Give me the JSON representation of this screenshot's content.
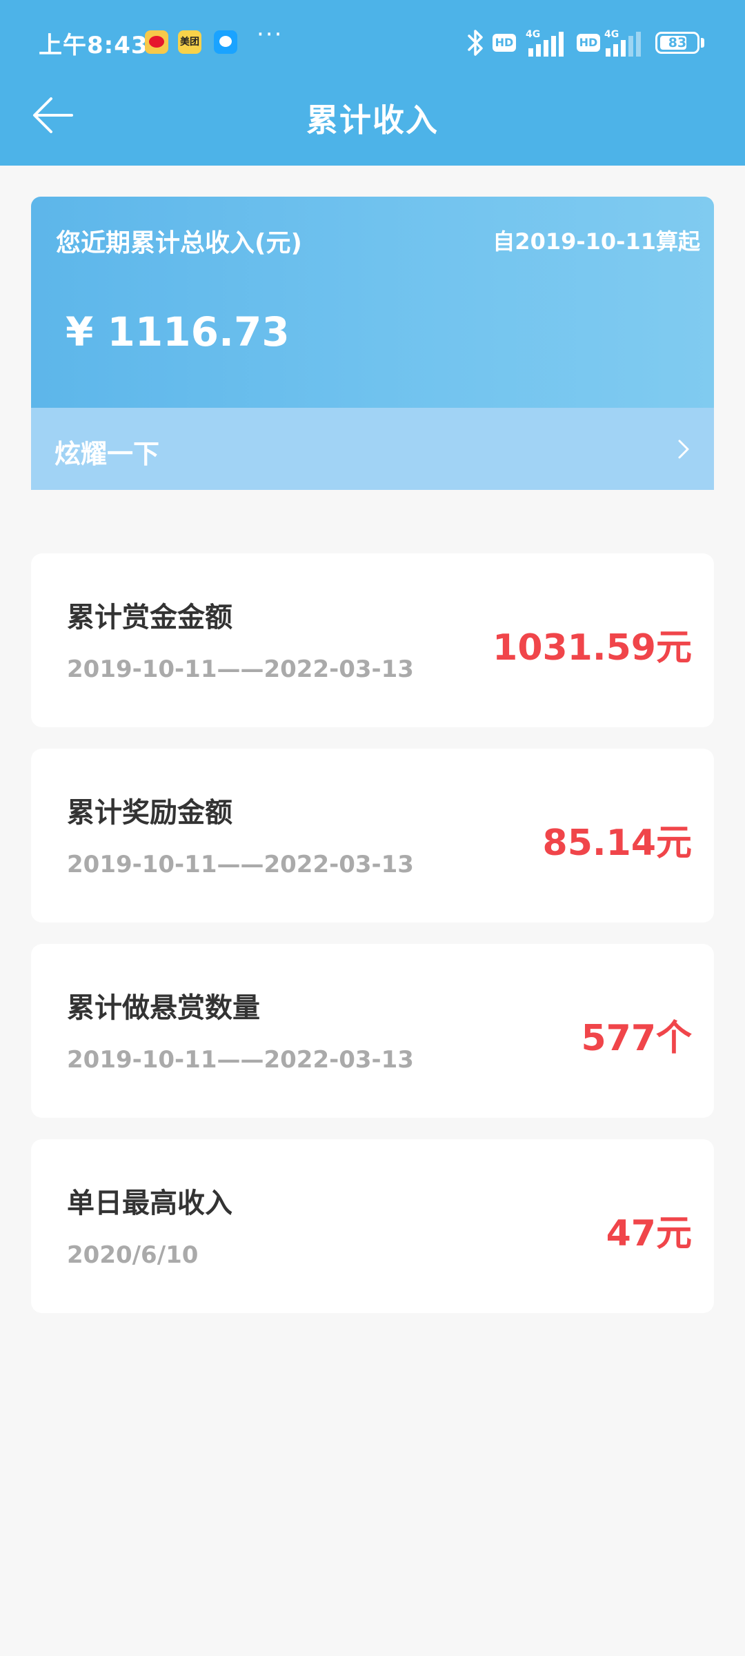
{
  "status_bar": {
    "time": "上午8:43",
    "meituan_label": "美团",
    "more": "···",
    "hd1": "HD",
    "net1": "4G",
    "hd2": "HD",
    "net2": "4G",
    "battery": "83"
  },
  "header": {
    "title": "累计收入",
    "icon": "back-arrow-icon"
  },
  "summary": {
    "label": "您近期累计总收入(元)",
    "since": "自2019-10-11算起",
    "total": "¥ 1116.73",
    "share_label": "炫耀一下",
    "share_icon": "chevron-right-icon"
  },
  "stats": [
    {
      "title": "累计赏金金额",
      "range": "2019-10-11——2022-03-13",
      "value": "1031.59元"
    },
    {
      "title": "累计奖励金额",
      "range": "2019-10-11——2022-03-13",
      "value": "85.14元"
    },
    {
      "title": "累计做悬赏数量",
      "range": "2019-10-11——2022-03-13",
      "value": "577个"
    },
    {
      "title": "单日最高收入",
      "range": "2020/6/10",
      "value": "47元"
    }
  ],
  "colors": {
    "header_bg": "#4db3e8",
    "value_red": "#f0454a",
    "share_bar": "#a1d3f5",
    "page_bg": "#f7f7f7"
  }
}
